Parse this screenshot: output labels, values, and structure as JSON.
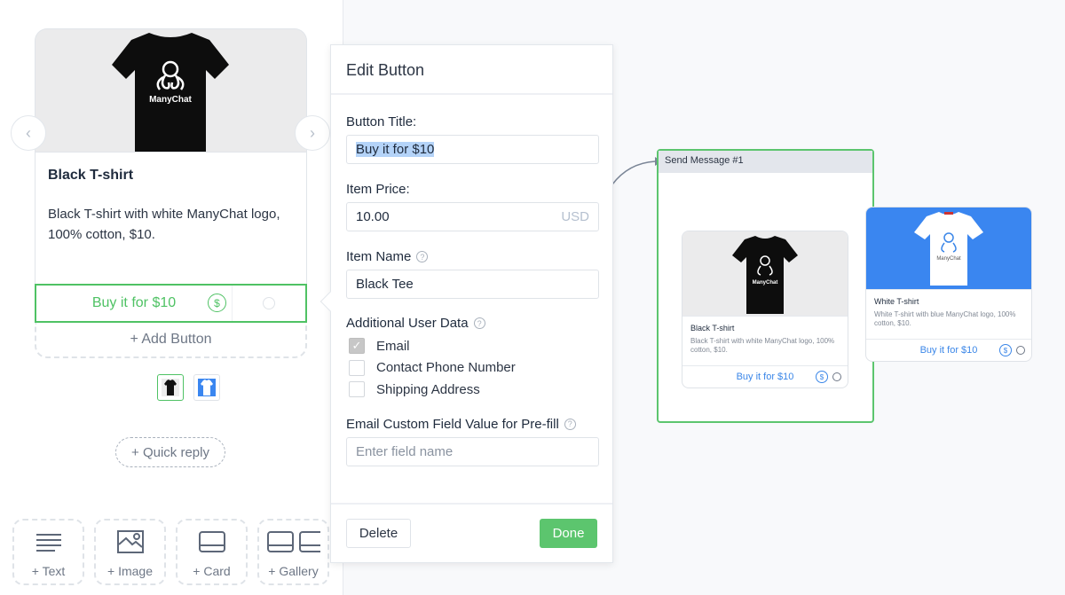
{
  "editor": {
    "card": {
      "title": "Black T-shirt",
      "description": "Black T-shirt with white ManyChat logo, 100% cotton, $10.",
      "image_logo_text": "ManyChat",
      "button_label": "Buy it for $10",
      "dollar_symbol": "$",
      "add_button_label": "+ Add Button",
      "prev_arrow": "‹",
      "next_arrow": "›"
    },
    "thumbnails": [
      {
        "name": "Black T-shirt",
        "active": true
      },
      {
        "name": "White T-shirt",
        "active": false
      }
    ],
    "quick_reply_label": "+ Quick reply",
    "add_blocks": [
      {
        "label": "+ Text",
        "icon": "text-lines-icon"
      },
      {
        "label": "+ Image",
        "icon": "image-icon"
      },
      {
        "label": "+ Card",
        "icon": "card-icon"
      },
      {
        "label": "+ Gallery",
        "icon": "gallery-icon"
      }
    ]
  },
  "edit_button": {
    "header": "Edit Button",
    "button_title_label": "Button Title:",
    "button_title_value": "Buy it for $10",
    "item_price_label": "Item Price:",
    "item_price_value": "10.00",
    "item_price_currency": "USD",
    "item_name_label": "Item Name",
    "item_name_value": "Black Tee",
    "help_glyph": "?",
    "additional_data_label": "Additional User Data",
    "checkboxes": [
      {
        "label": "Email",
        "checked": true
      },
      {
        "label": "Contact Phone Number",
        "checked": false
      },
      {
        "label": "Shipping Address",
        "checked": false
      }
    ],
    "email_field_label": "Email Custom Field Value for Pre-fill",
    "email_field_placeholder": "Enter field name",
    "delete_label": "Delete",
    "done_label": "Done",
    "check_glyph": "✓"
  },
  "flow": {
    "node_title": "Send Message #1",
    "cards": [
      {
        "title": "Black T-shirt",
        "description": "Black T-shirt with white ManyChat logo, 100% cotton, $10.",
        "button_label": "Buy it for $10",
        "logo_text": "ManyChat"
      },
      {
        "title": "White T-shirt",
        "description": "White T-shirt with blue ManyChat logo, 100% cotton, $10.",
        "button_label": "Buy it for $10",
        "logo_text": "ManyChat"
      }
    ]
  },
  "colors": {
    "accent_green": "#4fc264",
    "done_green": "#5cc56e",
    "link_blue": "#3a86e8",
    "white_tee_bg": "#3a86f0",
    "canvas_bg": "#f8f9fb"
  }
}
